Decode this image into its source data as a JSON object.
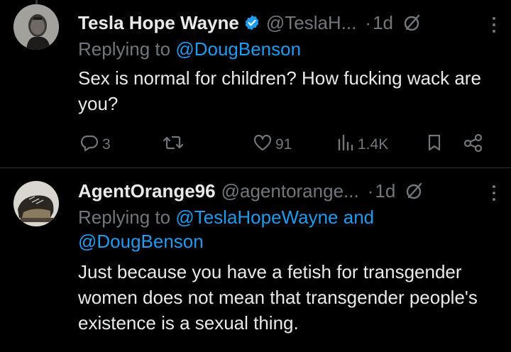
{
  "tweets": [
    {
      "display_name": "Tesla Hope Wayne",
      "handle": "@TeslaH...",
      "dot": "·",
      "time": "1d",
      "replying_to_prefix": "Replying to ",
      "replying_to_mention": "@DougBenson",
      "text": "Sex is normal for children? How fucking wack are you?",
      "verified": true,
      "actions": {
        "replies": "3",
        "retweets": "",
        "likes": "91",
        "views": "1.4K"
      }
    },
    {
      "display_name": "AgentOrange96",
      "handle": "@agentorange...",
      "dot": "·",
      "time": "1d",
      "replying_to_prefix": "Replying to ",
      "replying_to_mention": "@TeslaHopeWayne and @DougBenson",
      "text": "Just because you have a fetish for transgender women does not mean that transgender people's existence is a sexual thing.",
      "verified": false
    }
  ],
  "colors": {
    "background": "#000000",
    "text": "#e7e9ea",
    "muted": "#71767b",
    "accent": "#1d9bf0",
    "divider": "#2f3336"
  },
  "icons": [
    "verified-badge-icon",
    "grok-icon",
    "more-icon",
    "reply-icon",
    "retweet-icon",
    "like-icon",
    "views-icon",
    "bookmark-icon",
    "share-icon"
  ]
}
